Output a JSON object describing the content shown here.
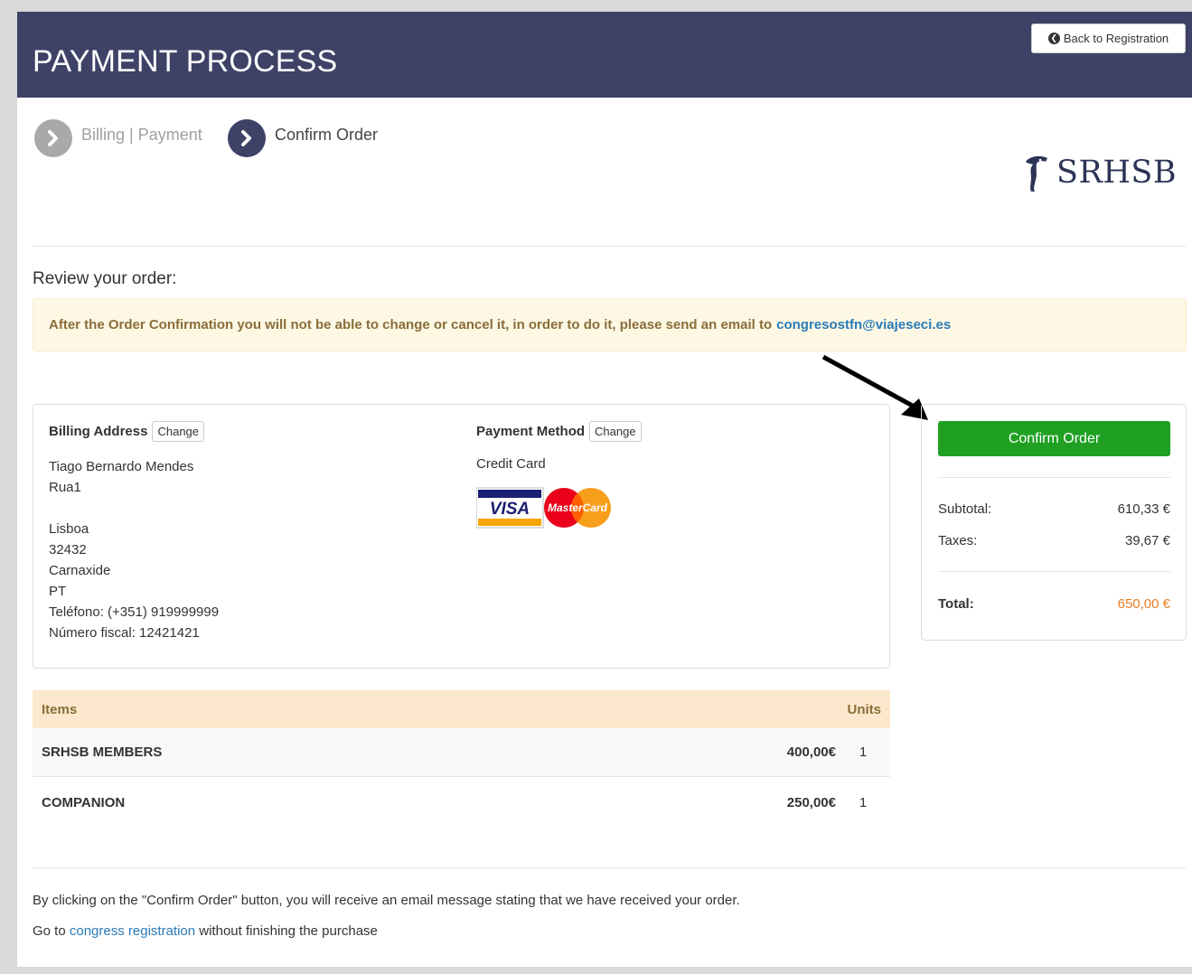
{
  "header": {
    "title": "PAYMENT PROCESS",
    "back_button": "Back to Registration"
  },
  "steps": [
    {
      "label": "Billing | Payment",
      "state": "done"
    },
    {
      "label": "Confirm Order",
      "state": "current"
    }
  ],
  "logo": {
    "text": "SRHSB"
  },
  "review": {
    "title": "Review your order:",
    "warning_text": "After the Order Confirmation you will not be able to change or cancel it, in order to do it, please send an email to",
    "warning_email": "congresostfn@viajeseci.es"
  },
  "billing": {
    "title": "Billing Address",
    "change_label": "Change",
    "lines": [
      "Tiago Bernardo Mendes",
      "Rua1",
      "",
      "Lisboa",
      "32432",
      "Carnaxide",
      "PT",
      "Teléfono: (+351) 919999999",
      "Número fiscal: 12421421"
    ]
  },
  "payment": {
    "title": "Payment Method",
    "change_label": "Change",
    "method": "Credit Card",
    "card_logos": [
      "VISA",
      "MasterCard"
    ]
  },
  "summary": {
    "confirm_label": "Confirm Order",
    "subtotal_label": "Subtotal:",
    "subtotal_value": "610,33 €",
    "taxes_label": "Taxes:",
    "taxes_value": "39,67 €",
    "total_label": "Total:",
    "total_value": "650,00 €"
  },
  "items": {
    "header_items": "Items",
    "header_units": "Units",
    "rows": [
      {
        "name": "SRHSB MEMBERS",
        "price": "400,00€",
        "units": "1"
      },
      {
        "name": "COMPANION",
        "price": "250,00€",
        "units": "1"
      }
    ]
  },
  "footer": {
    "notice": "By clicking on the \"Confirm Order\" button, you will receive an email message stating that we have received your order.",
    "goto_prefix": "Go to",
    "goto_link": "congress registration",
    "goto_suffix": "without finishing the purchase"
  },
  "colors": {
    "header_bg": "#3d4266",
    "confirm_green": "#1fa023",
    "total_orange": "#e67e22",
    "link_blue": "#2a7ab8"
  }
}
